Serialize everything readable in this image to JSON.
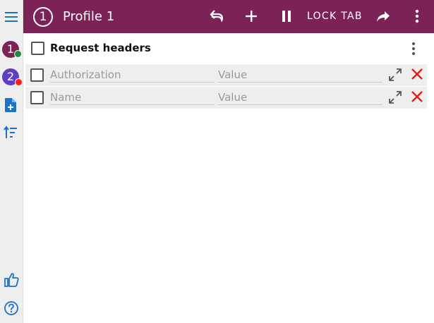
{
  "header": {
    "profile_number": "1",
    "profile_title": "Profile 1",
    "lock_tab_label": "LOCK TAB",
    "background_color": "#7b2257"
  },
  "sidebar": {
    "profiles": [
      {
        "number": "1",
        "color": "#7b2257",
        "status": "check-badge"
      },
      {
        "number": "2",
        "color": "#5e3fbf",
        "status": "error-badge"
      }
    ],
    "icons": [
      "menu-icon",
      "add-file-icon",
      "sort-icon",
      "thumbs-up-icon",
      "help-icon"
    ]
  },
  "section": {
    "title": "Request headers"
  },
  "rows": [
    {
      "name_placeholder": "Authorization",
      "value_placeholder": "Value",
      "name": "",
      "value": ""
    },
    {
      "name_placeholder": "Name",
      "value_placeholder": "Value",
      "name": "",
      "value": ""
    }
  ],
  "colors": {
    "accent": "#7b2257",
    "sidebar_blue": "#1a73c8",
    "remove_red": "#e81a1a",
    "row_background": "#eeeeee"
  }
}
